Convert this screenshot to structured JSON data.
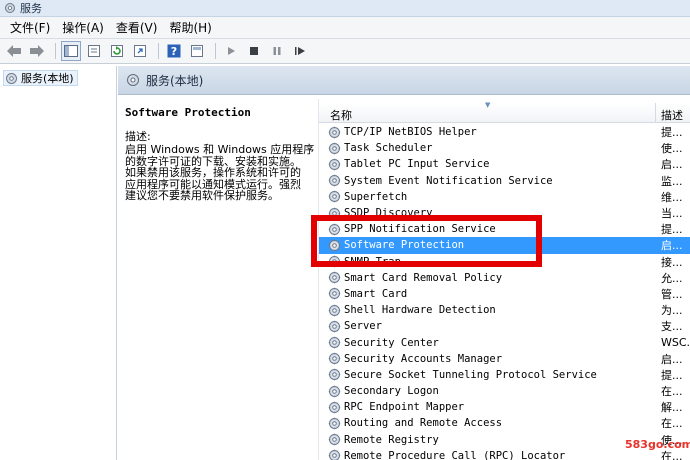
{
  "window": {
    "title": "服务"
  },
  "menu": [
    {
      "label": "文件(F)"
    },
    {
      "label": "操作(A)"
    },
    {
      "label": "查看(V)"
    },
    {
      "label": "帮助(H)"
    }
  ],
  "toolbar": {
    "icons": [
      "back-icon",
      "forward-icon",
      "console-tree-icon",
      "properties-icon",
      "refresh-icon",
      "export-list-icon",
      "help-icon",
      "view-icon",
      "start-icon",
      "stop-icon",
      "pause-icon",
      "restart-icon"
    ]
  },
  "tree": {
    "root_label": "服务(本地)"
  },
  "main": {
    "header_label": "服务(本地)"
  },
  "description": {
    "title": "Software Protection",
    "label": "描述:",
    "lines": [
      "启用 Windows 和 Windows 应用程序",
      "的数字许可证的下载、安装和实施。",
      "如果禁用该服务，操作系统和许可的",
      "应用程序可能以通知模式运行。强烈",
      "建议您不要禁用软件保护服务。"
    ]
  },
  "list": {
    "col_name": "名称",
    "col_desc": "描述",
    "rows": [
      {
        "name": "TCP/IP NetBIOS Helper",
        "desc": "提..."
      },
      {
        "name": "Task Scheduler",
        "desc": "使..."
      },
      {
        "name": "Tablet PC Input Service",
        "desc": "启..."
      },
      {
        "name": "System Event Notification Service",
        "desc": "监..."
      },
      {
        "name": "Superfetch",
        "desc": "维..."
      },
      {
        "name": "SSDP Discovery",
        "desc": "当..."
      },
      {
        "name": "SPP Notification Service",
        "desc": "提..."
      },
      {
        "name": "Software Protection",
        "desc": "启...",
        "selected": true
      },
      {
        "name": "SNMP Trap",
        "desc": "接..."
      },
      {
        "name": "Smart Card Removal Policy",
        "desc": "允..."
      },
      {
        "name": "Smart Card",
        "desc": "管..."
      },
      {
        "name": "Shell Hardware Detection",
        "desc": "为..."
      },
      {
        "name": "Server",
        "desc": "支..."
      },
      {
        "name": "Security Center",
        "desc": "WSC..."
      },
      {
        "name": "Security Accounts Manager",
        "desc": "启..."
      },
      {
        "name": "Secure Socket Tunneling Protocol Service",
        "desc": "提..."
      },
      {
        "name": "Secondary Logon",
        "desc": "在..."
      },
      {
        "name": "RPC Endpoint Mapper",
        "desc": "解..."
      },
      {
        "name": "Routing and Remote Access",
        "desc": "在..."
      },
      {
        "name": "Remote Registry",
        "desc": "使..."
      },
      {
        "name": "Remote Procedure Call (RPC) Locator",
        "desc": "在..."
      }
    ]
  },
  "watermark": "583go.com",
  "colors": {
    "selection": "#3399ff",
    "highlight_box": "#e20000",
    "watermark": "#e8322a"
  }
}
